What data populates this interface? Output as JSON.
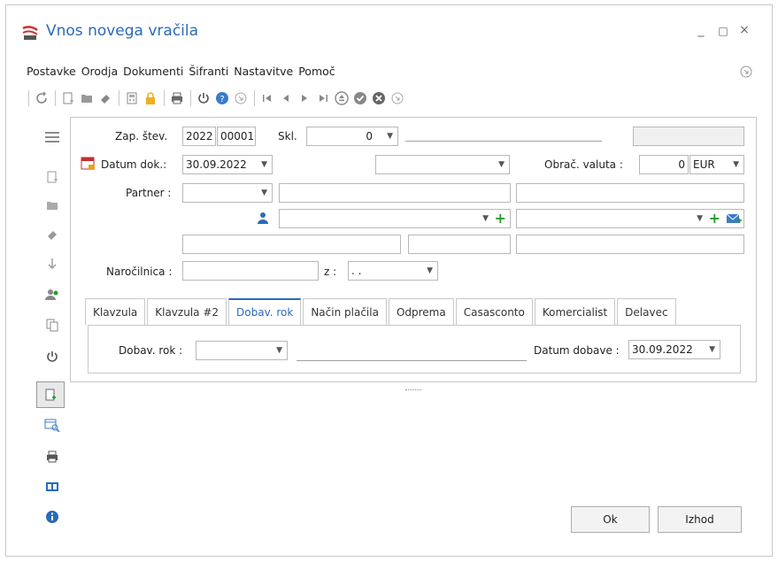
{
  "window": {
    "title": "Vnos novega vračila",
    "controls": {
      "minimize": "_",
      "maximize": "□",
      "close": "×"
    }
  },
  "menu": [
    "Postavke",
    "Orodja",
    "Dokumenti",
    "Šifranti",
    "Nastavitve",
    "Pomoč"
  ],
  "toolbar_icons": [
    "refresh-icon",
    "new-doc-icon",
    "folder-icon",
    "eraser-icon",
    "calculator-icon",
    "lock-icon",
    "print-icon",
    "power-icon",
    "help-icon",
    "circle-arrow-icon",
    "first-icon",
    "prev-icon",
    "next-icon",
    "last-icon",
    "eject-icon",
    "check-icon",
    "cancel-icon",
    "forward-icon"
  ],
  "sidebar_icons": [
    "menu-icon",
    "new-doc-icon",
    "folder-icon",
    "eraser-icon",
    "arrow-down-icon",
    "users-icon",
    "copy-icon",
    "power-icon",
    "add-doc-icon",
    "table-search-icon",
    "print-icon",
    "panel-icon",
    "info-icon"
  ],
  "form": {
    "zap_stev_label": "Zap. štev.",
    "year": "2022",
    "number": "00001",
    "skl_label": "Skl.",
    "skl_value": "0",
    "datum_dok_label": "Datum dok.:",
    "datum_dok": "30.09.2022",
    "obrac_valuta_label": "Obrač. valuta :",
    "valuta_value": "0",
    "currency": "EUR",
    "partner_label": "Partner :",
    "narocilnica_label": "Naročilnica :",
    "z_label": "z :",
    "z_value": ". ."
  },
  "tabs": [
    "Klavzula",
    "Klavzula #2",
    "Dobav. rok",
    "Način plačila",
    "Odprema",
    "Casasconto",
    "Komercialist",
    "Delavec"
  ],
  "active_tab": "Dobav. rok",
  "tab_panel": {
    "dobav_rok_label": "Dobav. rok :",
    "datum_dobave_label": "Datum dobave :",
    "datum_dobave": "30.09.2022"
  },
  "buttons": {
    "ok": "Ok",
    "exit": "Izhod"
  },
  "colors": {
    "accent": "#2a6ab8",
    "green": "#2a9a2a",
    "orange": "#f0a020"
  }
}
